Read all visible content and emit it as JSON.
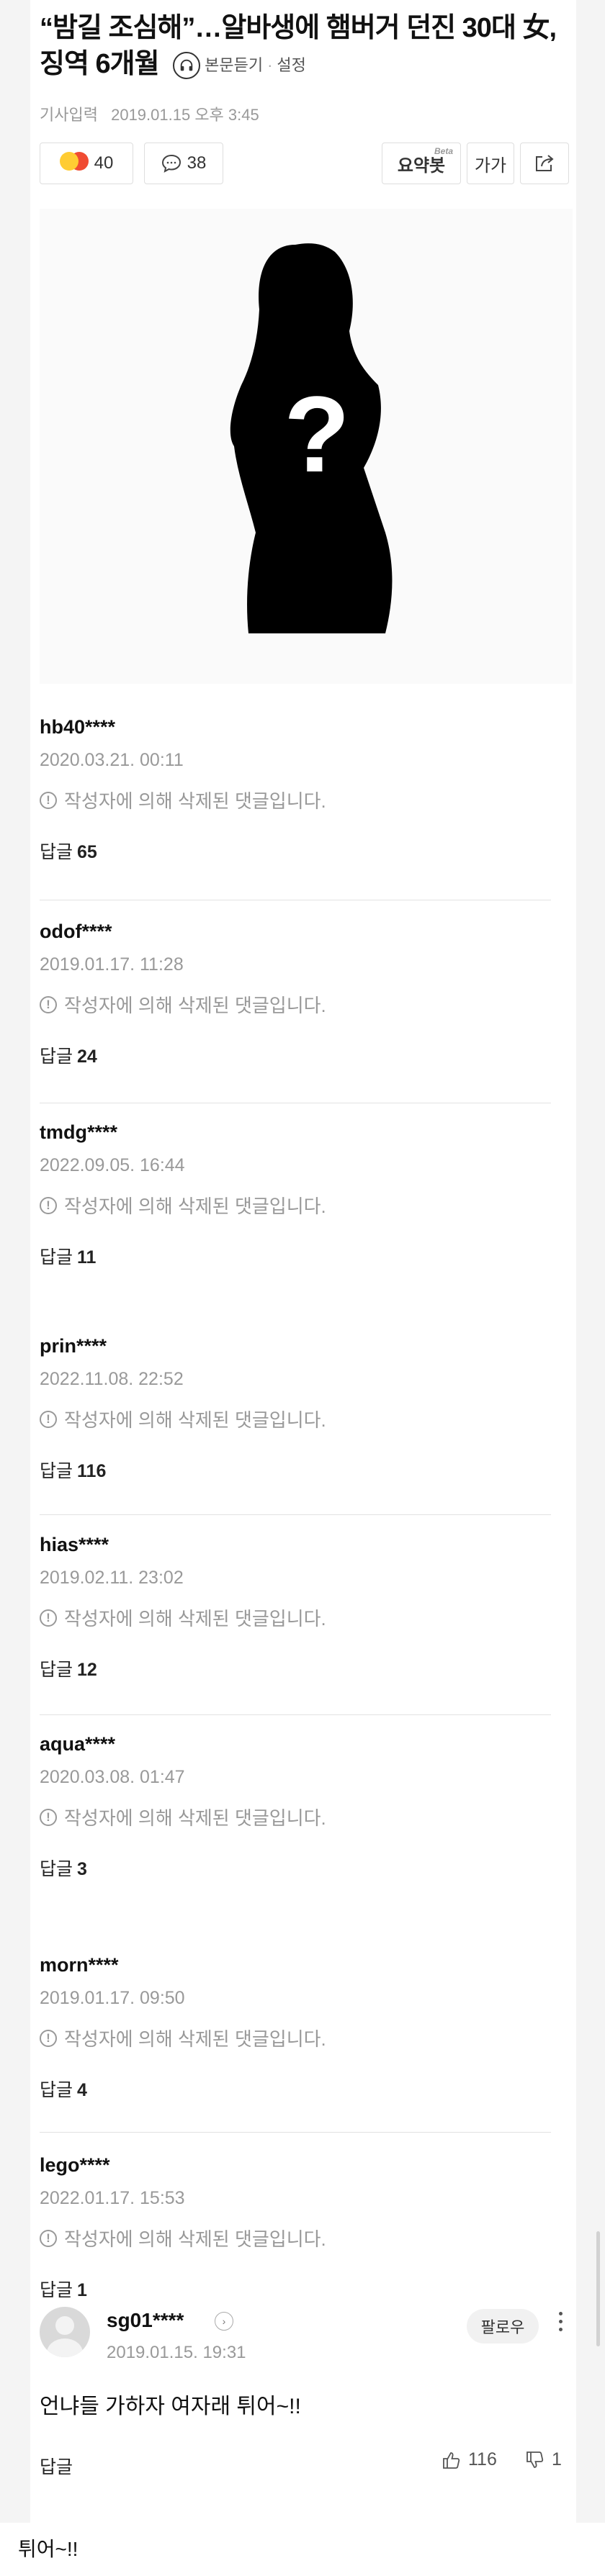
{
  "article": {
    "title": "“밤길 조심해”…알바생에 햄버거 던진 30대 女, 징역 6개월",
    "listen_label": "본문듣기",
    "settings_label": "설정",
    "date_prefix": "기사입력",
    "date": "2019.01.15 오후 3:45"
  },
  "actions": {
    "reactions_count": "40",
    "comments_count": "38",
    "summary_label": "요약봇",
    "summary_badge": "Beta",
    "font_label": "가가"
  },
  "comments": [
    {
      "user": "hb40****",
      "date": "2020.03.21. 00:11",
      "text": "작성자에 의해 삭제된 댓글입니다.",
      "reply_label": "답글",
      "reply_count": "65"
    },
    {
      "user": "odof****",
      "date": "2019.01.17. 11:28",
      "text": "작성자에 의해 삭제된 댓글입니다.",
      "reply_label": "답글",
      "reply_count": "24"
    },
    {
      "user": "tmdg****",
      "date": "2022.09.05. 16:44",
      "text": "작성자에 의해 삭제된 댓글입니다.",
      "reply_label": "답글",
      "reply_count": "11"
    },
    {
      "user": "prin****",
      "date": "2022.11.08. 22:52",
      "text": "작성자에 의해 삭제된 댓글입니다.",
      "reply_label": "답글",
      "reply_count": "116"
    },
    {
      "user": "hias****",
      "date": "2019.02.11. 23:02",
      "text": "작성자에 의해 삭제된 댓글입니다.",
      "reply_label": "답글",
      "reply_count": "12"
    },
    {
      "user": "aqua****",
      "date": "2020.03.08. 01:47",
      "text": "작성자에 의해 삭제된 댓글입니다.",
      "reply_label": "답글",
      "reply_count": "3"
    },
    {
      "user": "morn****",
      "date": "2019.01.17. 09:50",
      "text": "작성자에 의해 삭제된 댓글입니다.",
      "reply_label": "답글",
      "reply_count": "4"
    },
    {
      "user": "lego****",
      "date": "2022.01.17. 15:53",
      "text": "작성자에 의해 삭제된 댓글입니다.",
      "reply_label": "답글",
      "reply_count": "1"
    }
  ],
  "last_comment": {
    "user": "sg01****",
    "date": "2019.01.15. 19:31",
    "follow_label": "팔로우",
    "text": "언냐들 가하자 여자래 튀어~!!",
    "reply_label": "답글",
    "likes": "116",
    "dislikes": "1"
  },
  "caption": "튀어~!!"
}
